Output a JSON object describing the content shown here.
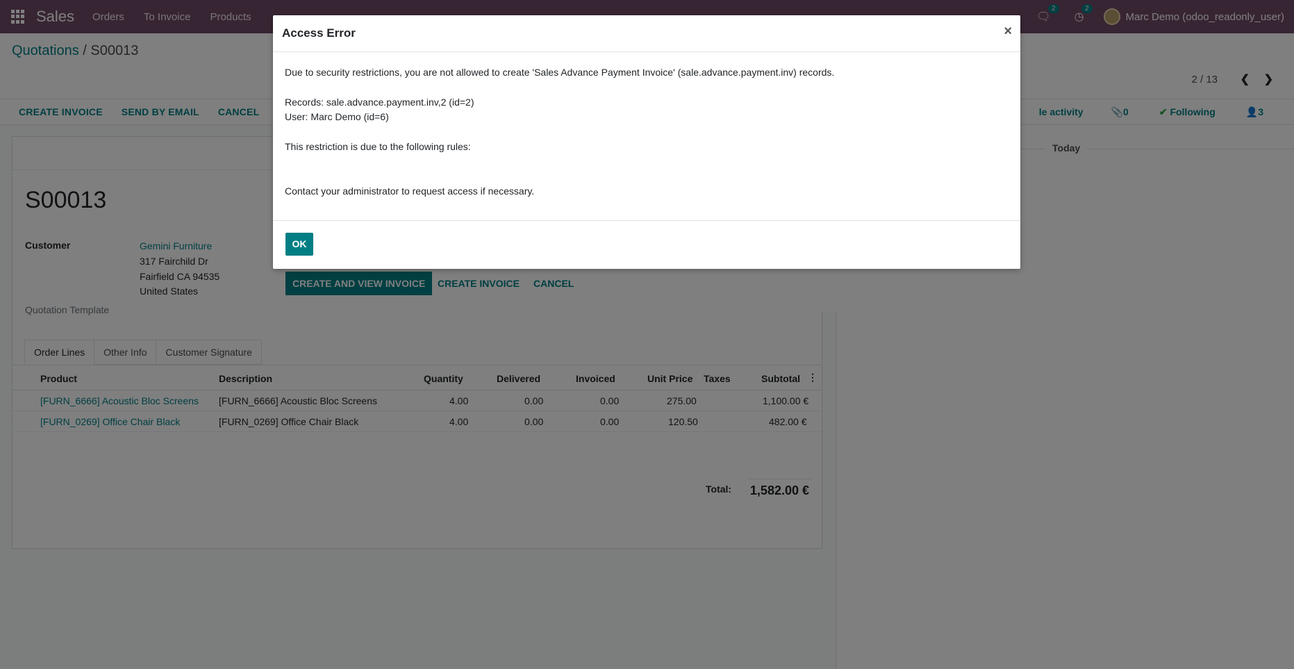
{
  "navbar": {
    "brand": "Sales",
    "menu": [
      "Orders",
      "To Invoice",
      "Products"
    ],
    "messages_count": "2",
    "activities_count": "2",
    "user": "Marc Demo (odoo_readonly_user)"
  },
  "breadcrumb": {
    "parent": "Quotations",
    "separator": "/",
    "current": "S00013"
  },
  "pager": {
    "value": "2 / 13"
  },
  "statusbar": {
    "buttons": [
      "CREATE INVOICE",
      "SEND BY EMAIL",
      "CANCEL"
    ]
  },
  "chatter": {
    "schedule_activity": "le activity",
    "attachments": "0",
    "following": "Following",
    "followers": "3",
    "today": "Today"
  },
  "form": {
    "name": "S00013",
    "customer_label": "Customer",
    "customer_name": "Gemini Furniture",
    "address": [
      "317 Fairchild Dr",
      "Fairfield CA 94535",
      "United States"
    ],
    "template_label": "Quotation Template",
    "tabs": [
      "Order Lines",
      "Other Info",
      "Customer Signature"
    ],
    "columns": [
      "Product",
      "Description",
      "Quantity",
      "Delivered",
      "Invoiced",
      "Unit Price",
      "Taxes",
      "Subtotal"
    ],
    "lines": [
      {
        "product": "[FURN_6666] Acoustic Bloc Screens",
        "description": "[FURN_6666] Acoustic Bloc Screens",
        "quantity": "4.00",
        "delivered": "0.00",
        "invoiced": "0.00",
        "unit_price": "275.00",
        "taxes": "",
        "subtotal": "1,100.00 €"
      },
      {
        "product": "[FURN_0269] Office Chair Black",
        "description": "[FURN_0269] Office Chair Black",
        "quantity": "4.00",
        "delivered": "0.00",
        "invoiced": "0.00",
        "unit_price": "120.50",
        "taxes": "",
        "subtotal": "482.00 €"
      }
    ],
    "total_label": "Total:",
    "total_value": "1,582.00 €"
  },
  "wizard": {
    "primary": "CREATE AND VIEW INVOICE",
    "create": "CREATE INVOICE",
    "cancel": "CANCEL"
  },
  "modal": {
    "title": "Access Error",
    "close": "×",
    "line1": "Due to security restrictions, you are not allowed to create 'Sales Advance Payment Invoice' (sale.advance.payment.inv) records.",
    "line2": "Records: sale.advance.payment.inv,2 (id=2)",
    "line3": "User: Marc Demo (id=6)",
    "line4": "This restriction is due to the following rules:",
    "line5": "Contact your administrator to request access if necessary.",
    "ok": "OK"
  },
  "colors": {
    "navbar": "#714b67",
    "primary": "#017e84",
    "success": "#28a745"
  }
}
